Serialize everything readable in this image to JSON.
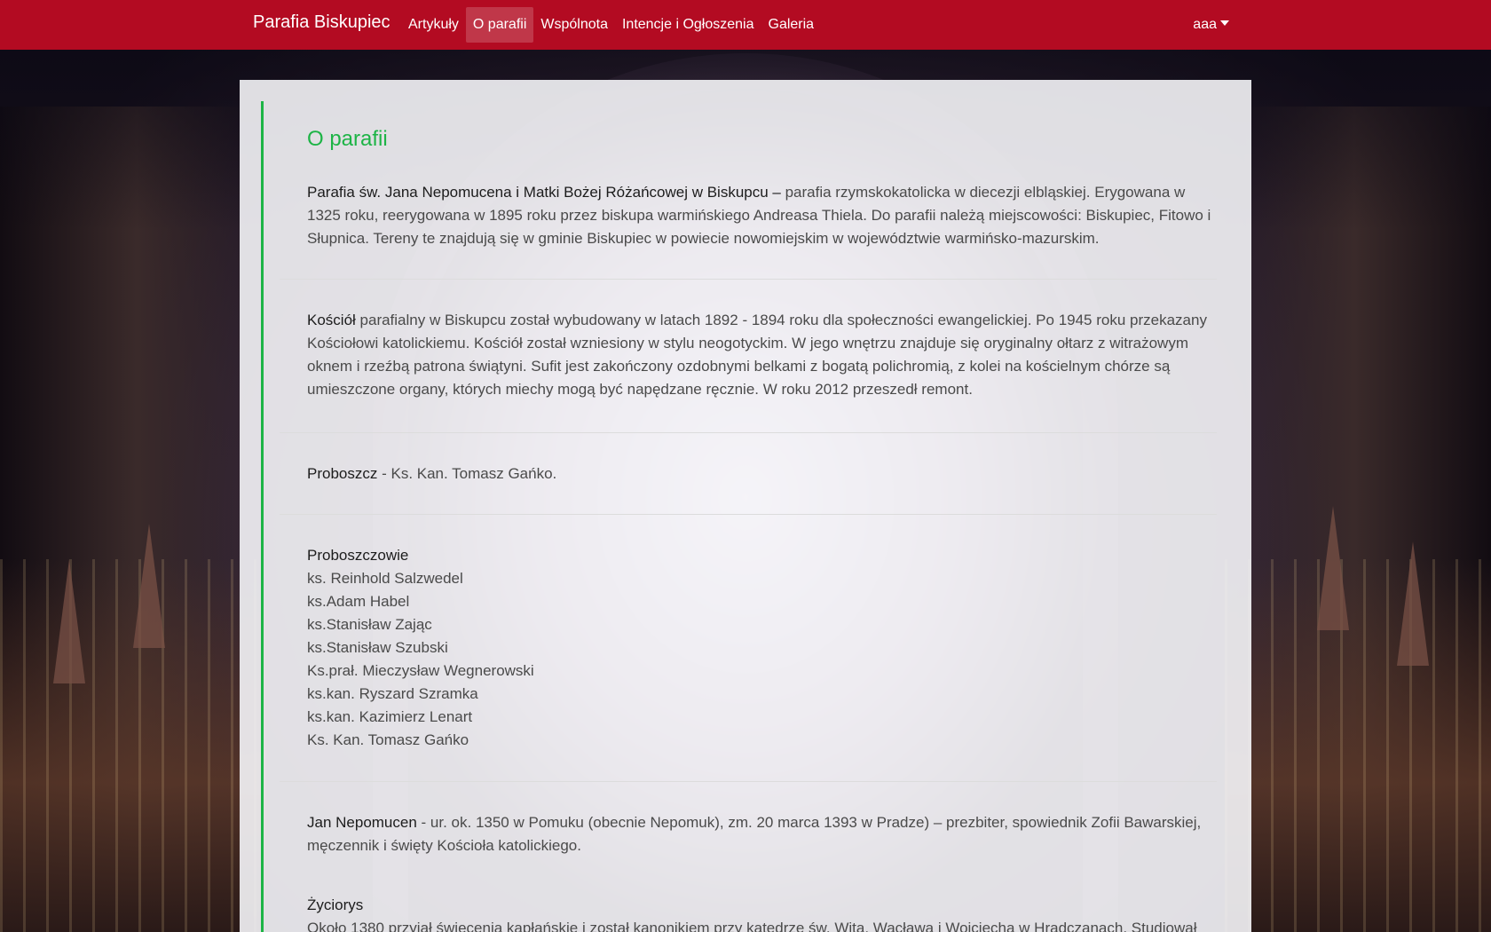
{
  "navbar": {
    "brand": "Parafia Biskupiec",
    "items": [
      {
        "label": "Artykuły"
      },
      {
        "label": "O parafii"
      },
      {
        "label": "Wspólnota"
      },
      {
        "label": "Intencje i Ogłoszenia"
      },
      {
        "label": "Galeria"
      }
    ],
    "user": "aaa",
    "color": "#b30b22"
  },
  "content": {
    "title": "O parafii",
    "accent_color": "#1db446",
    "sections": {
      "parish": {
        "lead": "Parafia św. Jana Nepomucena i Matki Bożej Różańcowej w Biskupcu –",
        "text": " parafia rzymskokatolicka w diecezji elbląskiej. Erygowana w 1325 roku, reerygowana w 1895 roku przez biskupa warmińskiego Andreasa Thiela. Do parafii należą miejscowości: Biskupiec, Fitowo i Słupnica. Tereny te znajdują się w gminie Biskupiec w powiecie nowomiejskim w województwie warmińsko-mazurskim."
      },
      "church": {
        "lead": "Kościół",
        "text": " parafialny w Biskupcu został wybudowany w latach 1892 - 1894 roku dla społeczności ewangelickiej. Po 1945 roku przekazany Kościołowi katolickiemu. Kościół został wzniesiony w stylu neogotyckim. W jego wnętrzu znajduje się oryginalny ołtarz z witrażowym oknem i rzeźbą patrona świątyni. Sufit jest zakończony ozdobnymi belkami z bogatą polichromią, z kolei na kościelnym chórze są umieszczone organy, których miechy mogą być napędzane ręcznie. W roku 2012 przeszedł remont."
      },
      "pastor": {
        "lead": "Proboszcz",
        "text": " - Ks. Kan. Tomasz Gańko."
      },
      "pastors": {
        "heading": "Proboszczowie",
        "names": [
          "ks. Reinhold Salzwedel",
          "ks.Adam Habel",
          "ks.Stanisław Zając",
          "ks.Stanisław Szubski",
          "Ks.prał. Mieczysław Wegnerowski",
          "ks.kan. Ryszard Szramka",
          "ks.kan. Kazimierz Lenart",
          "Ks. Kan. Tomasz Gańko"
        ]
      },
      "nepomucen": {
        "lead": "Jan Nepomucen",
        "text": " - ur. ok. 1350 w Pomuku (obecnie Nepomuk), zm. 20 marca 1393 w Pradze) – prezbiter, spowiednik Zofii Bawarskiej, męczennik i święty Kościoła katolickiego."
      },
      "biography": {
        "heading": "Życiorys",
        "text": "Około 1380 przyjął święcenia kapłańskie i został kanonikiem przy katedrze św. Wita, Wacława i Wojciecha w Hradczanach. Studiował"
      }
    }
  }
}
